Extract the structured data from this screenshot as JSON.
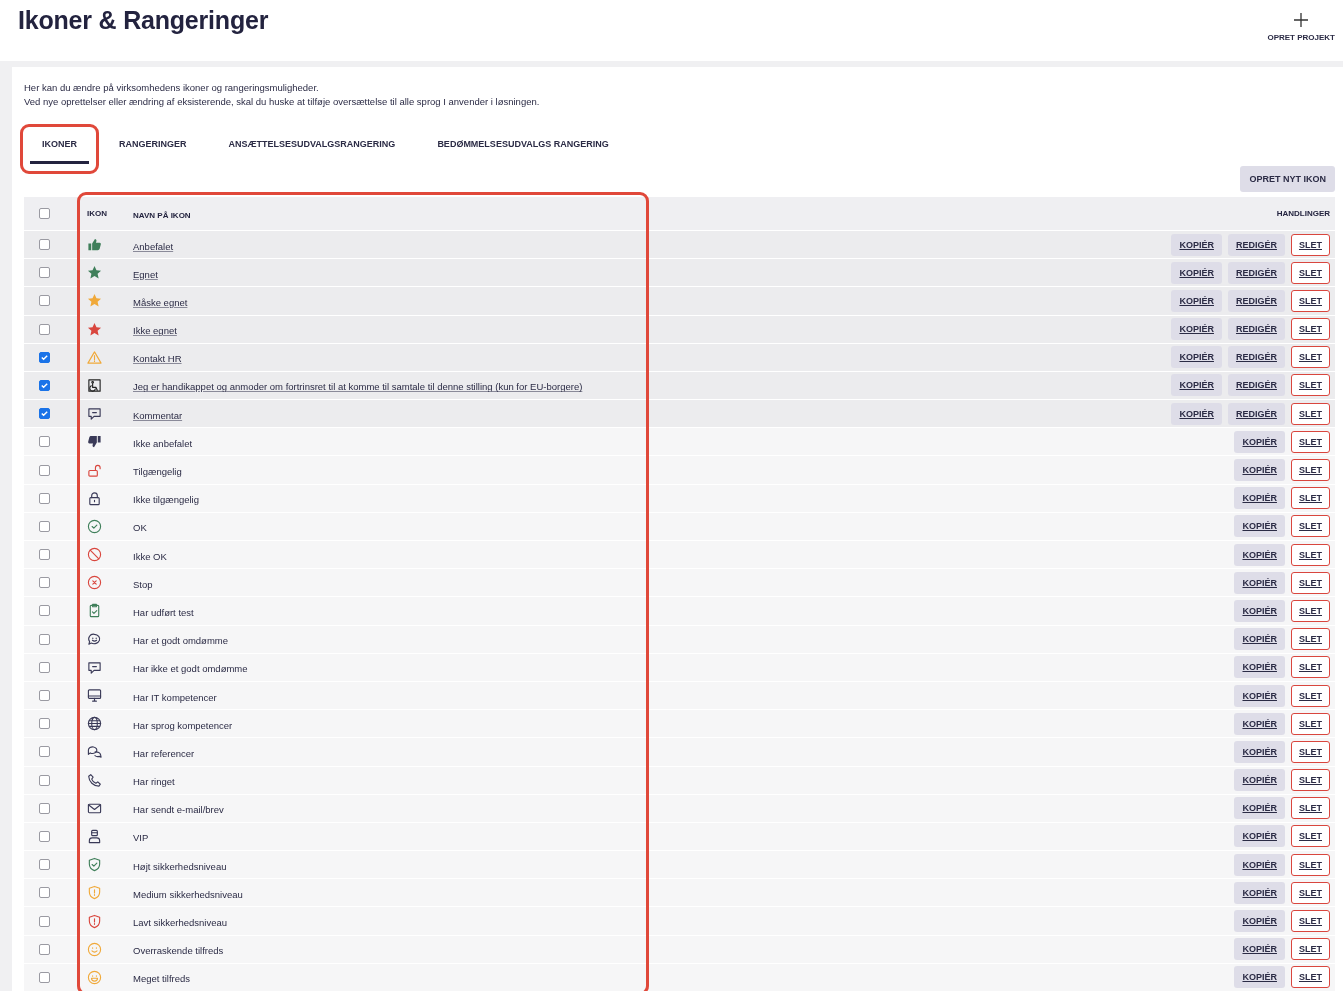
{
  "page": {
    "title": "Ikoner & Rangeringer",
    "create_project": "OPRET PROJEKT"
  },
  "intro": [
    "Her kan du ændre på virksomhedens ikoner og rangeringsmuligheder.",
    "Ved nye oprettelser eller ændring af eksisterende, skal du huske at tilføje oversættelse til alle sprog I anvender i løsningen."
  ],
  "tabs": [
    {
      "label": "IKONER",
      "selected": true,
      "highlighted": true
    },
    {
      "label": "RANGERINGER",
      "selected": false,
      "highlighted": false
    },
    {
      "label": "ANSÆTTELSESUDVALGSRANGERING",
      "selected": false,
      "highlighted": false
    },
    {
      "label": "BEDØMMELSESUDVALGS RANGERING",
      "selected": false,
      "highlighted": false
    }
  ],
  "create_button": "OPRET NYT IKON",
  "table": {
    "select_all_checked": false,
    "highlighted": true,
    "columns": [
      "IKON",
      "NAVN PÅ IKON",
      "HANDLINGER"
    ],
    "rows": [
      {
        "name": "Anbefalet",
        "checked": false,
        "custom": true,
        "actions": [
          {
            "label": "KOPIÉR",
            "kind": "secondary"
          },
          {
            "label": "REDIGÉR",
            "kind": "secondary"
          },
          {
            "label": "SLET",
            "kind": "danger"
          }
        ]
      },
      {
        "name": "Egnet",
        "checked": false,
        "custom": true,
        "actions": [
          {
            "label": "KOPIÉR",
            "kind": "secondary"
          },
          {
            "label": "REDIGÉR",
            "kind": "secondary"
          },
          {
            "label": "SLET",
            "kind": "danger"
          }
        ]
      },
      {
        "name": "Måske egnet",
        "checked": false,
        "custom": true,
        "actions": [
          {
            "label": "KOPIÉR",
            "kind": "secondary"
          },
          {
            "label": "REDIGÉR",
            "kind": "secondary"
          },
          {
            "label": "SLET",
            "kind": "danger"
          }
        ]
      },
      {
        "name": "Ikke egnet",
        "checked": false,
        "custom": true,
        "actions": [
          {
            "label": "KOPIÉR",
            "kind": "secondary"
          },
          {
            "label": "REDIGÉR",
            "kind": "secondary"
          },
          {
            "label": "SLET",
            "kind": "danger"
          }
        ]
      },
      {
        "name": "Kontakt HR",
        "checked": true,
        "custom": true,
        "actions": [
          {
            "label": "KOPIÉR",
            "kind": "secondary"
          },
          {
            "label": "REDIGÉR",
            "kind": "secondary"
          },
          {
            "label": "SLET",
            "kind": "danger"
          }
        ]
      },
      {
        "name": "Jeg er handikappet og anmoder om fortrinsret til at komme til samtale til denne stilling (kun for EU-borgere)",
        "checked": true,
        "custom": true,
        "actions": [
          {
            "label": "KOPIÉR",
            "kind": "secondary"
          },
          {
            "label": "REDIGÉR",
            "kind": "secondary"
          },
          {
            "label": "SLET",
            "kind": "danger"
          }
        ]
      },
      {
        "name": "Kommentar",
        "checked": true,
        "custom": true,
        "actions": [
          {
            "label": "KOPIÉR",
            "kind": "secondary"
          },
          {
            "label": "REDIGÉR",
            "kind": "secondary"
          },
          {
            "label": "SLET",
            "kind": "danger"
          }
        ]
      },
      {
        "name": "Ikke anbefalet",
        "checked": false,
        "custom": false,
        "actions": [
          {
            "label": "KOPIÉR",
            "kind": "secondary"
          },
          {
            "label": "SLET",
            "kind": "danger"
          }
        ]
      },
      {
        "name": "Tilgængelig",
        "checked": false,
        "custom": false,
        "actions": [
          {
            "label": "KOPIÉR",
            "kind": "secondary"
          },
          {
            "label": "SLET",
            "kind": "danger"
          }
        ]
      },
      {
        "name": "Ikke tilgængelig",
        "checked": false,
        "custom": false,
        "actions": [
          {
            "label": "KOPIÉR",
            "kind": "secondary"
          },
          {
            "label": "SLET",
            "kind": "danger"
          }
        ]
      },
      {
        "name": "OK",
        "checked": false,
        "custom": false,
        "actions": [
          {
            "label": "KOPIÉR",
            "kind": "secondary"
          },
          {
            "label": "SLET",
            "kind": "danger"
          }
        ]
      },
      {
        "name": "Ikke OK",
        "checked": false,
        "custom": false,
        "actions": [
          {
            "label": "KOPIÉR",
            "kind": "secondary"
          },
          {
            "label": "SLET",
            "kind": "danger"
          }
        ]
      },
      {
        "name": "Stop",
        "checked": false,
        "custom": false,
        "actions": [
          {
            "label": "KOPIÉR",
            "kind": "secondary"
          },
          {
            "label": "SLET",
            "kind": "danger"
          }
        ]
      },
      {
        "name": "Har udført test",
        "checked": false,
        "custom": false,
        "actions": [
          {
            "label": "KOPIÉR",
            "kind": "secondary"
          },
          {
            "label": "SLET",
            "kind": "danger"
          }
        ]
      },
      {
        "name": "Har et godt omdømme",
        "checked": false,
        "custom": false,
        "actions": [
          {
            "label": "KOPIÉR",
            "kind": "secondary"
          },
          {
            "label": "SLET",
            "kind": "danger"
          }
        ]
      },
      {
        "name": "Har ikke et godt omdømme",
        "checked": false,
        "custom": false,
        "actions": [
          {
            "label": "KOPIÉR",
            "kind": "secondary"
          },
          {
            "label": "SLET",
            "kind": "danger"
          }
        ]
      },
      {
        "name": "Har IT kompetencer",
        "checked": false,
        "custom": false,
        "actions": [
          {
            "label": "KOPIÉR",
            "kind": "secondary"
          },
          {
            "label": "SLET",
            "kind": "danger"
          }
        ]
      },
      {
        "name": "Har sprog kompetencer",
        "checked": false,
        "custom": false,
        "actions": [
          {
            "label": "KOPIÉR",
            "kind": "secondary"
          },
          {
            "label": "SLET",
            "kind": "danger"
          }
        ]
      },
      {
        "name": "Har referencer",
        "checked": false,
        "custom": false,
        "actions": [
          {
            "label": "KOPIÉR",
            "kind": "secondary"
          },
          {
            "label": "SLET",
            "kind": "danger"
          }
        ]
      },
      {
        "name": "Har ringet",
        "checked": false,
        "custom": false,
        "actions": [
          {
            "label": "KOPIÉR",
            "kind": "secondary"
          },
          {
            "label": "SLET",
            "kind": "danger"
          }
        ]
      },
      {
        "name": "Har sendt e-mail/brev",
        "checked": false,
        "custom": false,
        "actions": [
          {
            "label": "KOPIÉR",
            "kind": "secondary"
          },
          {
            "label": "SLET",
            "kind": "danger"
          }
        ]
      },
      {
        "name": "VIP",
        "checked": false,
        "custom": false,
        "actions": [
          {
            "label": "KOPIÉR",
            "kind": "secondary"
          },
          {
            "label": "SLET",
            "kind": "danger"
          }
        ]
      },
      {
        "name": "Højt sikkerhedsniveau",
        "checked": false,
        "custom": false,
        "actions": [
          {
            "label": "KOPIÉR",
            "kind": "secondary"
          },
          {
            "label": "SLET",
            "kind": "danger"
          }
        ]
      },
      {
        "name": "Medium sikkerhedsniveau",
        "checked": false,
        "custom": false,
        "actions": [
          {
            "label": "KOPIÉR",
            "kind": "secondary"
          },
          {
            "label": "SLET",
            "kind": "danger"
          }
        ]
      },
      {
        "name": "Lavt sikkerhedsniveau",
        "checked": false,
        "custom": false,
        "actions": [
          {
            "label": "KOPIÉR",
            "kind": "secondary"
          },
          {
            "label": "SLET",
            "kind": "danger"
          }
        ]
      },
      {
        "name": "Overraskende tilfreds",
        "checked": false,
        "custom": false,
        "actions": [
          {
            "label": "KOPIÉR",
            "kind": "secondary"
          },
          {
            "label": "SLET",
            "kind": "danger"
          }
        ]
      },
      {
        "name": "Meget tilfreds",
        "checked": false,
        "custom": false,
        "actions": [
          {
            "label": "KOPIÉR",
            "kind": "secondary"
          },
          {
            "label": "SLET",
            "kind": "danger"
          }
        ]
      }
    ]
  }
}
